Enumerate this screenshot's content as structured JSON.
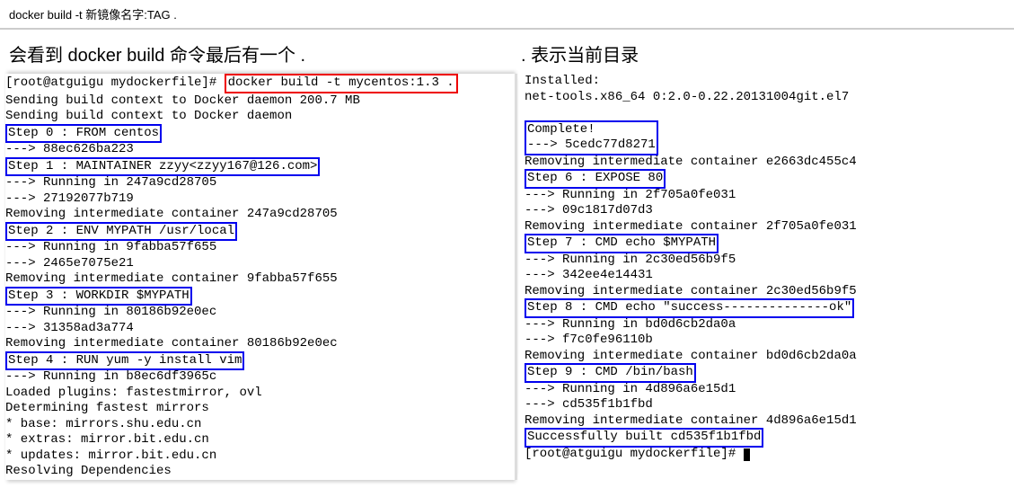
{
  "top": {
    "text": "docker build -t 新镜像名字:TAG ."
  },
  "headings": {
    "left": "会看到 docker build 命令最后有一个 .",
    "right": ". 表示当前目录"
  },
  "left": {
    "prompt": "[root@atguigu mydockerfile]# ",
    "cmd": "docker build -t mycentos:1.3 .",
    "l2": "Sending build context to Docker daemon 200.7 MB",
    "l3": "Sending build context to Docker daemon",
    "step0": "Step 0 : FROM centos",
    "l5": " ---> 88ec626ba223",
    "step1": "Step 1 : MAINTAINER zzyy<zzyy167@126.com>",
    "l7": " ---> Running in 247a9cd28705",
    "l8": " ---> 27192077b719",
    "l9": "Removing intermediate container 247a9cd28705",
    "step2": "Step 2 : ENV MYPATH /usr/local",
    "l11": " ---> Running in 9fabba57f655",
    "l12": " ---> 2465e7075e21",
    "l13": "Removing intermediate container 9fabba57f655",
    "step3": "Step 3 : WORKDIR $MYPATH",
    "l15": " ---> Running in 80186b92e0ec",
    "l16": " ---> 31358ad3a774",
    "l17": "Removing intermediate container 80186b92e0ec",
    "step4": "Step 4 : RUN yum -y install vim",
    "l19": " ---> Running in b8ec6df3965c",
    "l20": "Loaded plugins: fastestmirror, ovl",
    "l21": "Determining fastest mirrors",
    "l22": " * base: mirrors.shu.edu.cn",
    "l23": " * extras: mirror.bit.edu.cn",
    "l24": " * updates: mirror.bit.edu.cn",
    "l25": "Resolving Dependencies"
  },
  "right": {
    "r1": "Installed:",
    "r2": "  net-tools.x86_64 0:2.0-0.22.20131004git.el7",
    "complete": "Complete!",
    "r4": " ---> 5cedc77d8271",
    "r5": "Removing intermediate container e2663dc455c4",
    "step6": "Step 6 : EXPOSE 80",
    "r7": " ---> Running in 2f705a0fe031",
    "r8": " ---> 09c1817d07d3",
    "r9": "Removing intermediate container 2f705a0fe031",
    "step7": "Step 7 : CMD echo $MYPATH",
    "r11": " ---> Running in 2c30ed56b9f5",
    "r12": " ---> 342ee4e14431",
    "r13": "Removing intermediate container 2c30ed56b9f5",
    "step8": "Step 8 : CMD echo \"success--------------ok\"",
    "r15": " ---> Running in bd0d6cb2da0a",
    "r16": " ---> f7c0fe96110b",
    "r17": "Removing intermediate container bd0d6cb2da0a",
    "step9": "Step 9 : CMD /bin/bash",
    "r19": " ---> Running in 4d896a6e15d1",
    "r20": " ---> cd535f1b1fbd",
    "r21": "Removing intermediate container 4d896a6e15d1",
    "success": "Successfully built cd535f1b1fbd",
    "prompt2": "[root@atguigu mydockerfile]# "
  }
}
